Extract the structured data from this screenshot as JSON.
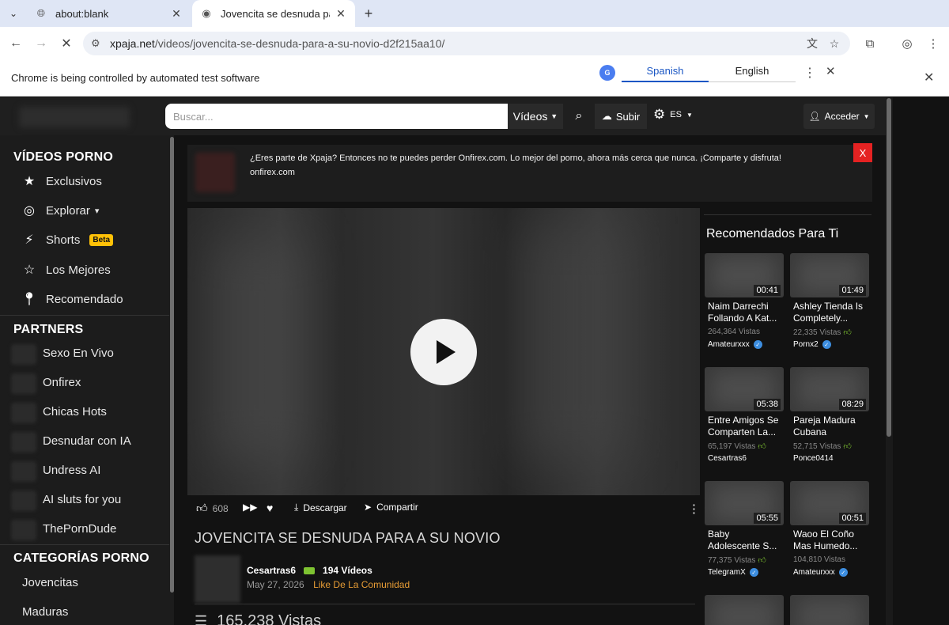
{
  "browser": {
    "tabs": [
      {
        "title": "about:blank",
        "icon": "globe-icon"
      },
      {
        "title": "Jovencita se desnuda par",
        "icon": "site-icon"
      }
    ],
    "url_host": "xpaja.net",
    "url_path": "/videos/jovencita-se-desnuda-para-a-su-novio-d2f215aa10/",
    "infobar_text": "Chrome is being controlled by automated test software",
    "translate": {
      "from": "Spanish",
      "to": "English"
    }
  },
  "header": {
    "search_placeholder": "Buscar...",
    "videos_label": "Vídeos",
    "upload_label": "Subir",
    "lang_label": "ES",
    "login_label": "Acceder"
  },
  "sidebar": {
    "section1_title": "VÍDEOS PORNO",
    "items": [
      {
        "label": "Exclusivos",
        "icon": "star-icon"
      },
      {
        "label": "Explorar",
        "icon": "compass-icon",
        "caret": "▾"
      },
      {
        "label": "Shorts",
        "icon": "bolt-icon",
        "badge": "Beta"
      },
      {
        "label": "Los Mejores",
        "icon": "star-outline-icon"
      },
      {
        "label": "Recomendado",
        "icon": "location-pin-icon"
      }
    ],
    "section2_title": "PARTNERS",
    "partners": [
      "Sexo En Vivo",
      "Onfirex",
      "Chicas Hots",
      "Desnudar con IA",
      "Undress AI",
      "AI sluts for you",
      "ThePornDude"
    ],
    "section3_title": "CATEGORÍAS PORNO",
    "categories": [
      "Jovencitas",
      "Maduras"
    ]
  },
  "promo": {
    "text": "¿Eres parte de Xpaja? Entonces no te puedes perder Onfirex.com. Lo mejor del porno, ahora más cerca que nunca. ¡Comparte y disfruta!",
    "link": "onfirex.com",
    "close": "X"
  },
  "video": {
    "likes": "608",
    "download_label": "Descargar",
    "share_label": "Compartir",
    "title": "JOVENCITA SE DESNUDA PARA A SU NOVIO",
    "uploader": "Cesartras6",
    "uploader_videos": "194 Vídeos",
    "date": "May 27, 2026",
    "community_label": "Like De La Comunidad",
    "views": "165,238 Vistas"
  },
  "recommended": {
    "title": "Recomendados Para Ti",
    "cards": [
      {
        "duration": "00:41",
        "title": "Naim Darrechi Follando A Kat...",
        "views": "264,364 Vistas",
        "author": "Amateurxxx"
      },
      {
        "duration": "01:49",
        "title": "Ashley Tienda Is Completely...",
        "views": "22,335 Vistas",
        "author": "Pornx2"
      },
      {
        "duration": "05:38",
        "title": "Entre Amigos Se Comparten La...",
        "views": "65,197 Vistas",
        "author": "Cesartras6"
      },
      {
        "duration": "08:29",
        "title": "Pareja Madura Cubana",
        "views": "52,715 Vistas",
        "author": "Ponce0414"
      },
      {
        "duration": "05:55",
        "title": "Baby Adolescente S...",
        "views": "77,375 Vistas",
        "author": "TelegramX"
      },
      {
        "duration": "00:51",
        "title": "Waoo El Coño Mas Humedo...",
        "views": "104,810 Vistas",
        "author": "Amateurxxx"
      }
    ]
  }
}
